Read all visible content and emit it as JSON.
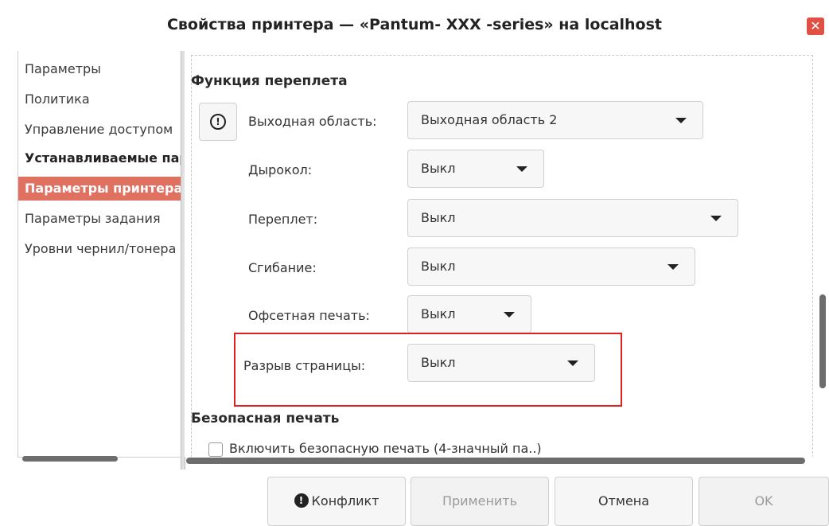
{
  "window": {
    "title": "Свойства принтера — «Pantum- XXX     -series» на localhost",
    "close_glyph": "✕"
  },
  "nav": {
    "items": [
      {
        "label": "Параметры"
      },
      {
        "label": "Политика"
      },
      {
        "label": "Управление доступом"
      },
      {
        "label": "Устанавливаемые параметры"
      },
      {
        "label": "Параметры принтера"
      },
      {
        "label": "Параметры задания"
      },
      {
        "label": "Уровни чернил/тонера"
      }
    ]
  },
  "content": {
    "binding_section_title": "Функция переплета",
    "rows": [
      {
        "label": "Выходная область:",
        "value": "Выходная область 2"
      },
      {
        "label": "Дырокол:",
        "value": "Выкл"
      },
      {
        "label": "Переплет:",
        "value": "Выкл"
      },
      {
        "label": "Сгибание:",
        "value": "Выкл"
      },
      {
        "label": "Офсетная печать:",
        "value": "Выкл"
      },
      {
        "label": "Разрыв страницы:",
        "value": "Выкл"
      }
    ],
    "secure_section_title": "Безопасная печать",
    "secure_checkbox_label": "Включить безопасную печать (4-значный па..)"
  },
  "buttons": {
    "conflict": "Конфликт",
    "apply": "Применить",
    "cancel": "Отмена",
    "ok": "OK"
  },
  "colors": {
    "active_nav": "#e07060",
    "highlight": "#e02020",
    "close": "#e05045"
  }
}
